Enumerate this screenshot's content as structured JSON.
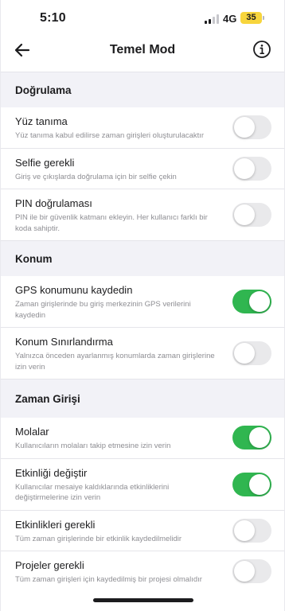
{
  "status_bar": {
    "time": "5:10",
    "network": "4G",
    "battery": "35"
  },
  "nav": {
    "title": "Temel Mod",
    "back_icon": "arrow-left-icon",
    "info_icon": "info-circle-icon"
  },
  "colors": {
    "toggle_on": "#30b650",
    "toggle_off": "#e9e9eb",
    "section_bg": "#f2f2f7",
    "battery": "#f7d53c"
  },
  "sections": [
    {
      "title": "Doğrulama",
      "items": [
        {
          "title": "Yüz tanıma",
          "subtitle": "Yüz tanıma kabul edilirse zaman girişleri oluşturulacaktır",
          "enabled": false
        },
        {
          "title": "Selfie gerekli",
          "subtitle": "Giriş ve çıkışlarda doğrulama için bir selfie çekin",
          "enabled": false
        },
        {
          "title": "PIN doğrulaması",
          "subtitle": "PIN ile bir güvenlik katmanı ekleyin. Her kullanıcı farklı bir koda sahiptir.",
          "enabled": false
        }
      ]
    },
    {
      "title": "Konum",
      "items": [
        {
          "title": "GPS konumunu kaydedin",
          "subtitle": "Zaman girişlerinde bu giriş merkezinin GPS verilerini kaydedin",
          "enabled": true
        },
        {
          "title": "Konum Sınırlandırma",
          "subtitle": "Yalnızca önceden ayarlanmış konumlarda zaman girişlerine izin verin",
          "enabled": false
        }
      ]
    },
    {
      "title": "Zaman Girişi",
      "items": [
        {
          "title": "Molalar",
          "subtitle": "Kullanıcıların molaları takip etmesine izin verin",
          "enabled": true
        },
        {
          "title": "Etkinliği değiştir",
          "subtitle": "Kullanıcılar mesaiye kaldıklarında etkinliklerini değiştirmelerine izin verin",
          "enabled": true
        },
        {
          "title": "Etkinlikleri gerekli",
          "subtitle": "Tüm zaman girişlerinde bir etkinlik kaydedilmelidir",
          "enabled": false
        },
        {
          "title": "Projeler gerekli",
          "subtitle": "Tüm zaman girişleri için kaydedilmiş bir projesi olmalıdır",
          "enabled": false
        }
      ]
    }
  ]
}
